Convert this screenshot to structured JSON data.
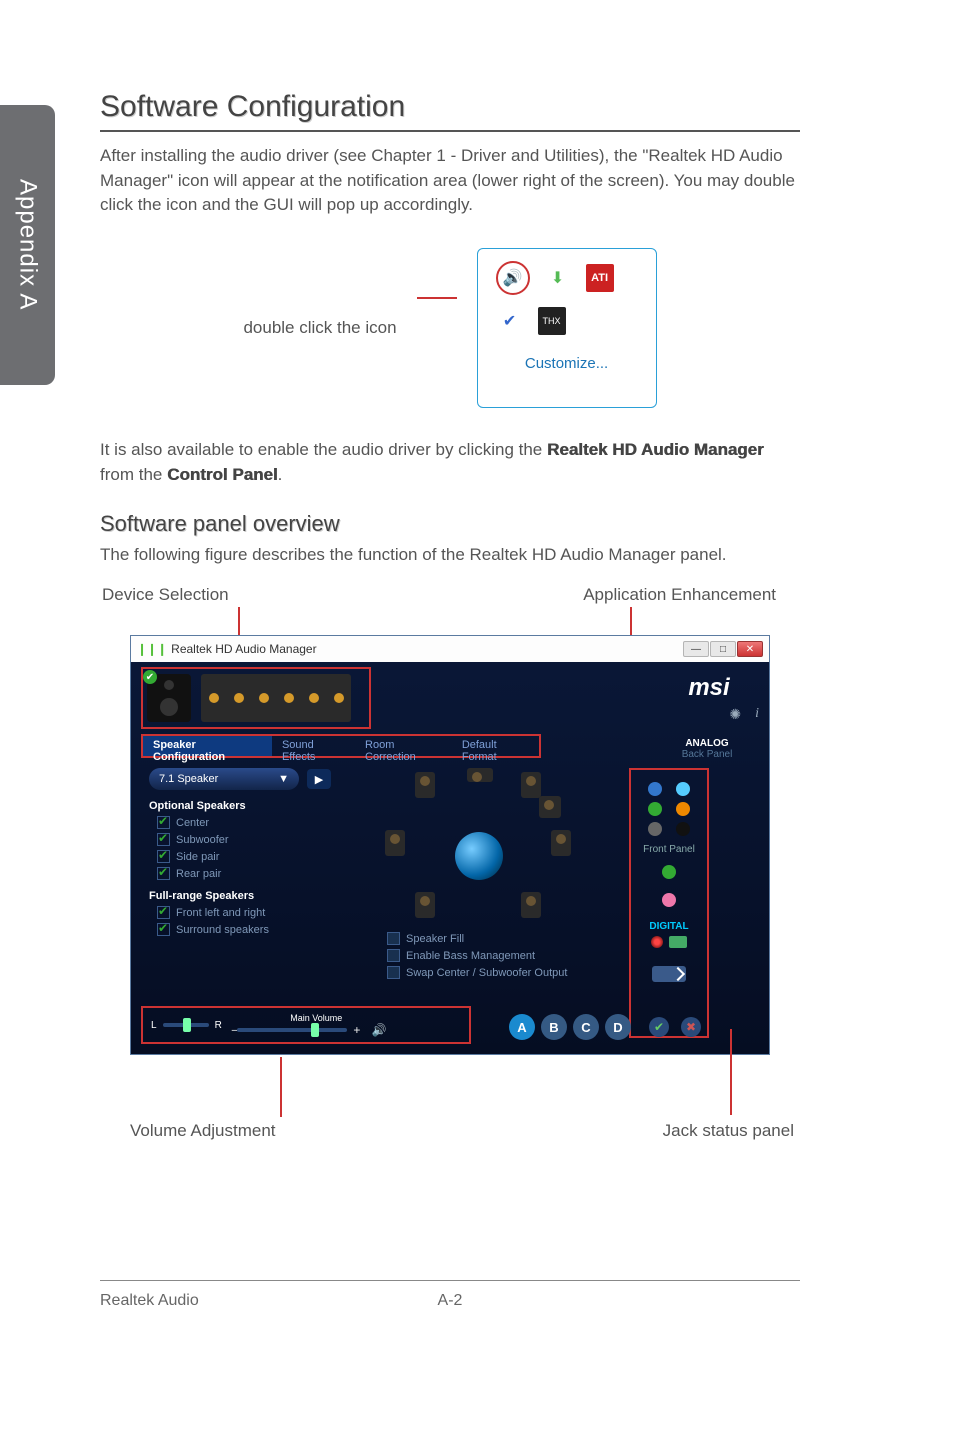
{
  "sideTab": "Appendix A",
  "heading": "Software Configuration",
  "intro": "After installing the audio driver (see Chapter 1 - Driver and Utilities), the \"Realtek HD Audio Manager\" icon will appear at the notification area (lower right of the screen). You may double click the icon and the GUI will pop up accordingly.",
  "dblClick": "double click the icon",
  "customize": "Customize...",
  "para2_a": "It is also available to enable the audio driver by clicking the ",
  "para2_b": "Realtek HD Audio Manager",
  "para2_c": " from the ",
  "para2_d": "Control Panel",
  "para2_e": ".",
  "subHeading": "Software panel overview",
  "para3": "The following figure describes the function of the Realtek HD Audio Manager panel.",
  "callouts": {
    "topLeft": "Device Selection",
    "topRight": "Application Enhancement",
    "botLeft": "Volume Adjustment",
    "botRight": "Jack status panel"
  },
  "panel": {
    "title": "Realtek HD Audio Manager",
    "msi": "msi",
    "analog": "ANALOG",
    "backPanel": "Back Panel",
    "frontPanel": "Front Panel",
    "digital": "DIGITAL",
    "tabs": {
      "spk": "Speaker Configuration",
      "fx": "Sound Effects",
      "room": "Room Correction",
      "fmt": "Default Format"
    },
    "sel": "7.1 Speaker",
    "optHdr": "Optional Speakers",
    "center": "Center",
    "sub": "Subwoofer",
    "side": "Side pair",
    "rear": "Rear pair",
    "fullHdr": "Full-range Speakers",
    "flr": "Front left and right",
    "surr": "Surround speakers",
    "m1": "Speaker Fill",
    "m2": "Enable Bass Management",
    "m3": "Swap Center / Subwoofer Output",
    "mainVol": "Main Volume",
    "L": "L",
    "R": "R",
    "A": "A",
    "B": "B",
    "C": "C",
    "D": "D"
  },
  "footer": {
    "left": "Realtek Audio",
    "page": "A-2"
  }
}
